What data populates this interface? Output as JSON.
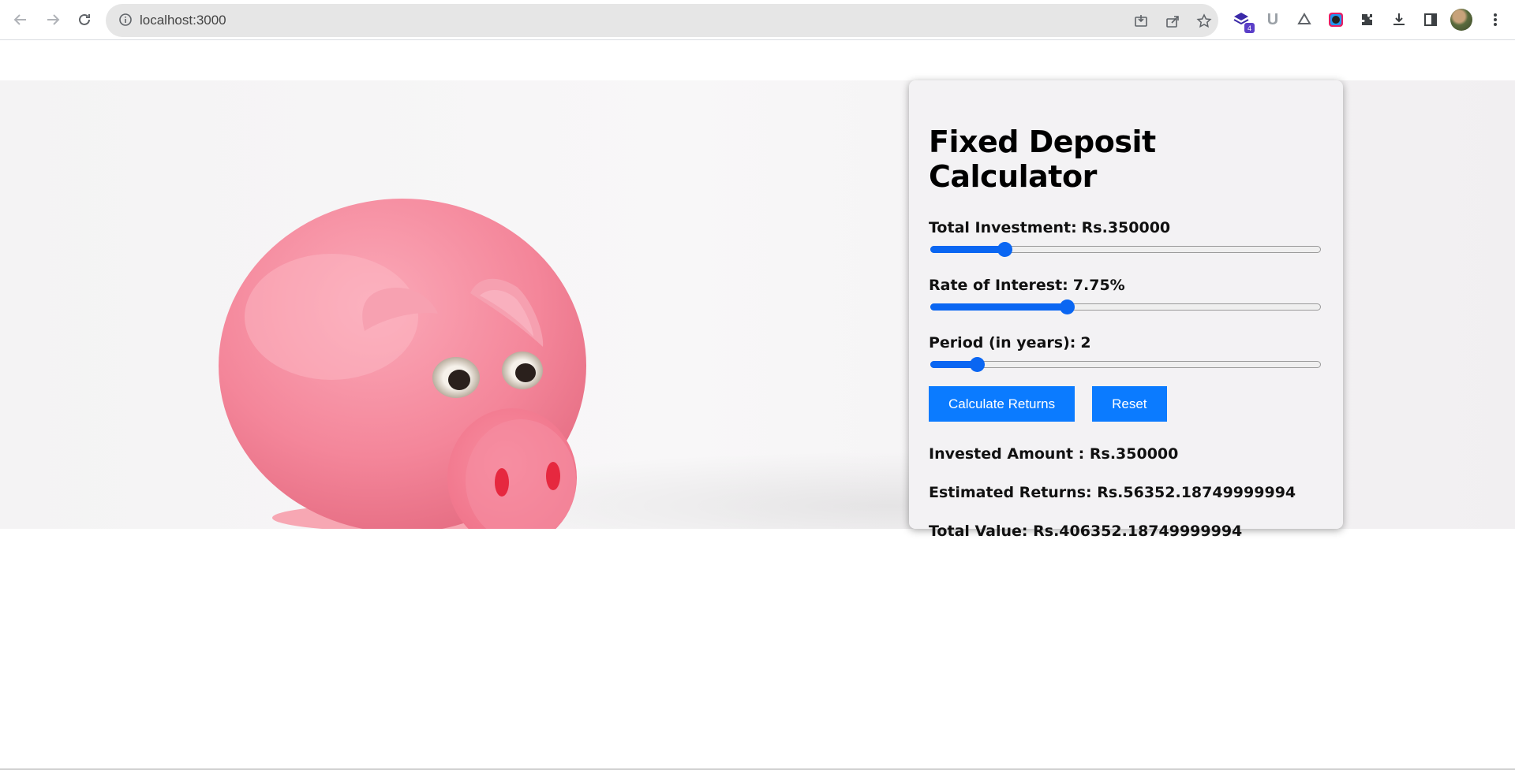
{
  "browser": {
    "url": "localhost:3000",
    "extension_badge": "4"
  },
  "calculator": {
    "title": "Fixed Deposit Calculator",
    "fields": [
      {
        "label": "Total Investment:",
        "value": "Rs.350000",
        "level": 0.19
      },
      {
        "label": "Rate of Interest:",
        "value": "7.75%",
        "level": 0.35
      },
      {
        "label": "Period (in years):",
        "value": "2",
        "level": 0.12
      }
    ],
    "calculate_label": "Calculate Returns",
    "reset_label": "Reset",
    "results": {
      "invested": "Invested Amount : Rs.350000",
      "estimated": "Estimated Returns: Rs.56352.18749999994",
      "total": "Total Value: Rs.406352.18749999994"
    }
  },
  "colors": {
    "accent": "#0b7bff",
    "slider": "#0a66f2"
  }
}
